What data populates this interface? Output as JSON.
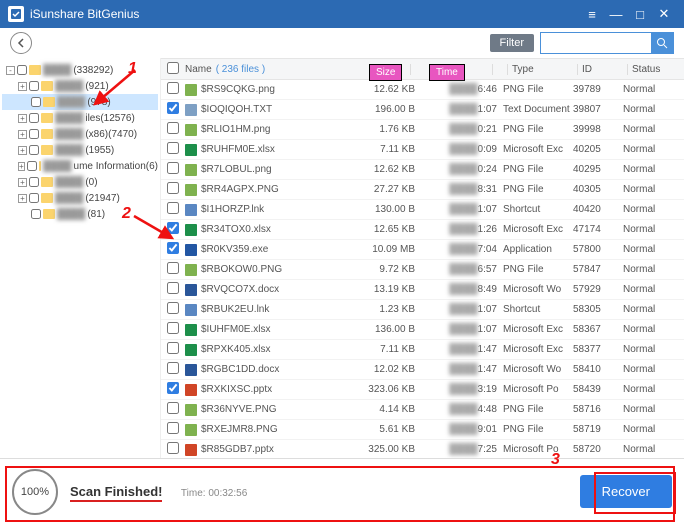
{
  "app": {
    "title": "iSunshare BitGenius"
  },
  "toolbar": {
    "filter": "Filter",
    "search_placeholder": ""
  },
  "tree": {
    "items": [
      {
        "label": "(338292)",
        "indent": 0,
        "tog": "-",
        "blur": true
      },
      {
        "label": "(921)",
        "indent": 1,
        "tog": "+",
        "blur": true
      },
      {
        "label": "(978)",
        "indent": 1,
        "tog": "",
        "blur": true,
        "sel": true
      },
      {
        "label": "iles(12576)",
        "indent": 1,
        "tog": "+",
        "blur": true
      },
      {
        "label": "(x86)(7470)",
        "indent": 1,
        "tog": "+",
        "blur": true
      },
      {
        "label": "(1955)",
        "indent": 1,
        "tog": "+",
        "blur": true
      },
      {
        "label": "ume Information(6)",
        "indent": 1,
        "tog": "+",
        "blur": true
      },
      {
        "label": "(0)",
        "indent": 1,
        "tog": "+",
        "blur": true
      },
      {
        "label": "(21947)",
        "indent": 1,
        "tog": "+",
        "blur": true
      },
      {
        "label": "(81)",
        "indent": 1,
        "tog": "",
        "blur": true
      }
    ]
  },
  "grid": {
    "head": {
      "name": "Name",
      "filecount": "( 236 files )",
      "size": "Size",
      "time": "Time",
      "type": "Type",
      "id": "ID",
      "status": "Status"
    },
    "rows": [
      {
        "cb": false,
        "name": "$RS9CQKG.png",
        "size": "12.62 KB",
        "tend": "6:46",
        "type": "PNG File",
        "id": "39789",
        "status": "Normal",
        "ic": "#7fb24f"
      },
      {
        "cb": true,
        "name": "$IOQIQOH.TXT",
        "size": "196.00 B",
        "tend": "1:07",
        "type": "Text Document",
        "id": "39807",
        "status": "Normal",
        "ic": "#7ea0c4"
      },
      {
        "cb": false,
        "name": "$RLIO1HM.png",
        "size": "1.76 KB",
        "tend": "0:21",
        "type": "PNG File",
        "id": "39998",
        "status": "Normal",
        "ic": "#7fb24f"
      },
      {
        "cb": false,
        "name": "$RUHFM0E.xlsx",
        "size": "7.11 KB",
        "tend": "0:09",
        "type": "Microsoft Exc",
        "id": "40205",
        "status": "Normal",
        "ic": "#1d8f4a"
      },
      {
        "cb": false,
        "name": "$R7LOBUL.png",
        "size": "12.62 KB",
        "tend": "0:24",
        "type": "PNG File",
        "id": "40295",
        "status": "Normal",
        "ic": "#7fb24f"
      },
      {
        "cb": false,
        "name": "$RR4AGPX.PNG",
        "size": "27.27 KB",
        "tend": "8:31",
        "type": "PNG File",
        "id": "40305",
        "status": "Normal",
        "ic": "#7fb24f"
      },
      {
        "cb": false,
        "name": "$I1HORZP.lnk",
        "size": "130.00 B",
        "tend": "1:07",
        "type": "Shortcut",
        "id": "40420",
        "status": "Normal",
        "ic": "#5a87c2"
      },
      {
        "cb": true,
        "name": "$R34TOX0.xlsx",
        "size": "12.65 KB",
        "tend": "1:26",
        "type": "Microsoft Exc",
        "id": "47174",
        "status": "Normal",
        "ic": "#1d8f4a"
      },
      {
        "cb": true,
        "name": "$R0KV359.exe",
        "size": "10.09 MB",
        "tend": "7:04",
        "type": "Application",
        "id": "57800",
        "status": "Normal",
        "ic": "#2256a3"
      },
      {
        "cb": false,
        "name": "$RBOKOW0.PNG",
        "size": "9.72 KB",
        "tend": "6:57",
        "type": "PNG File",
        "id": "57847",
        "status": "Normal",
        "ic": "#7fb24f"
      },
      {
        "cb": false,
        "name": "$RVQCO7X.docx",
        "size": "13.19 KB",
        "tend": "8:49",
        "type": "Microsoft Wo",
        "id": "57929",
        "status": "Normal",
        "ic": "#2a5699"
      },
      {
        "cb": false,
        "name": "$RBUK2EU.lnk",
        "size": "1.23 KB",
        "tend": "1:07",
        "type": "Shortcut",
        "id": "58305",
        "status": "Normal",
        "ic": "#5a87c2"
      },
      {
        "cb": false,
        "name": "$IUHFM0E.xlsx",
        "size": "136.00 B",
        "tend": "1:07",
        "type": "Microsoft Exc",
        "id": "58367",
        "status": "Normal",
        "ic": "#1d8f4a"
      },
      {
        "cb": false,
        "name": "$RPXK405.xlsx",
        "size": "7.11 KB",
        "tend": "1:47",
        "type": "Microsoft Exc",
        "id": "58377",
        "status": "Normal",
        "ic": "#1d8f4a"
      },
      {
        "cb": false,
        "name": "$RGBC1DD.docx",
        "size": "12.02 KB",
        "tend": "1:47",
        "type": "Microsoft Wo",
        "id": "58410",
        "status": "Normal",
        "ic": "#2a5699"
      },
      {
        "cb": true,
        "name": "$RXKIXSC.pptx",
        "size": "323.06 KB",
        "tend": "3:19",
        "type": "Microsoft Po",
        "id": "58439",
        "status": "Normal",
        "ic": "#d04526"
      },
      {
        "cb": false,
        "name": "$R36NYVE.PNG",
        "size": "4.14 KB",
        "tend": "4:48",
        "type": "PNG File",
        "id": "58716",
        "status": "Normal",
        "ic": "#7fb24f"
      },
      {
        "cb": false,
        "name": "$RXEJMR8.PNG",
        "size": "5.61 KB",
        "tend": "9:01",
        "type": "PNG File",
        "id": "58719",
        "status": "Normal",
        "ic": "#7fb24f"
      },
      {
        "cb": false,
        "name": "$R85GDB7.pptx",
        "size": "325.00 KB",
        "tend": "7:25",
        "type": "Microsoft Po",
        "id": "58720",
        "status": "Normal",
        "ic": "#d04526"
      }
    ]
  },
  "footer": {
    "pct": "100%",
    "finished": "Scan Finished!",
    "time_label": "Time:",
    "time_val": "00:32:56",
    "recover": "Recover"
  },
  "anno": {
    "n1": "1",
    "n2": "2",
    "n3": "3"
  }
}
